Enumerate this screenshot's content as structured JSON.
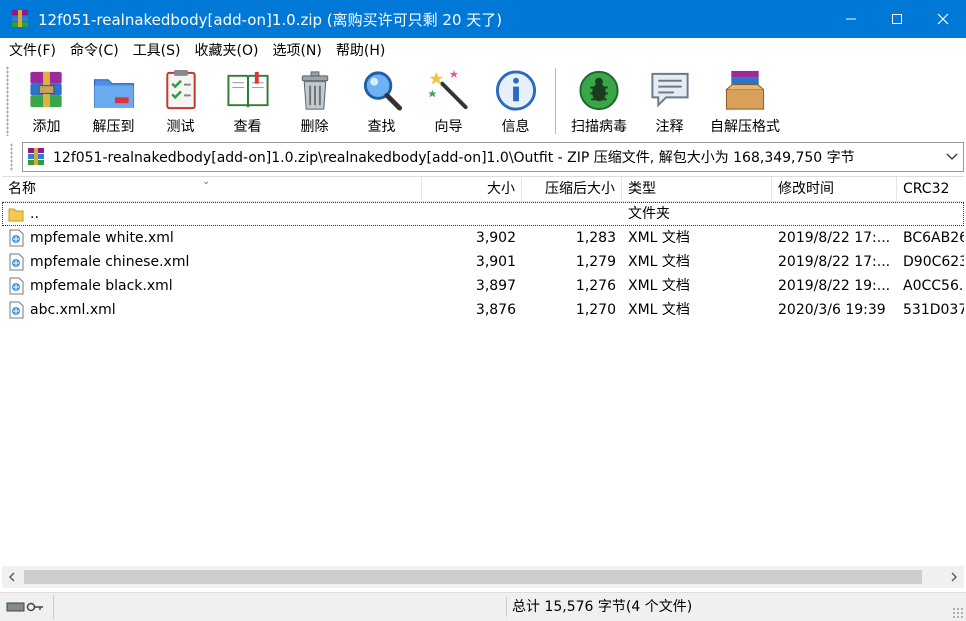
{
  "window": {
    "title": "12f051-realnakedbody[add-on]1.0.zip (离购买许可只剩 20 天了)",
    "accent_color": "#0078d7"
  },
  "menu": {
    "items": [
      "文件(F)",
      "命令(C)",
      "工具(S)",
      "收藏夹(O)",
      "选项(N)",
      "帮助(H)"
    ]
  },
  "toolbar": {
    "add": "添加",
    "extract": "解压到",
    "test": "测试",
    "view": "查看",
    "delete": "删除",
    "find": "查找",
    "wizard": "向导",
    "info": "信息",
    "scan": "扫描病毒",
    "comment": "注释",
    "sfx": "自解压格式"
  },
  "address": {
    "path": "12f051-realnakedbody[add-on]1.0.zip\\realnakedbody[add-on]1.0\\Outfit - ZIP 压缩文件, 解包大小为 168,349,750 字节"
  },
  "columns": {
    "name": "名称",
    "size": "大小",
    "packed": "压缩后大小",
    "type": "类型",
    "modified": "修改时间",
    "crc": "CRC32"
  },
  "rows": [
    {
      "name": "..",
      "size": "",
      "packed": "",
      "type": "文件夹",
      "modified": "",
      "crc": "",
      "icon": "folder-icon"
    },
    {
      "name": "mpfemale white.xml",
      "size": "3,902",
      "packed": "1,283",
      "type": "XML 文档",
      "modified": "2019/8/22 17:...",
      "crc": "BC6AB26",
      "icon": "xml-file-icon"
    },
    {
      "name": "mpfemale chinese.xml",
      "size": "3,901",
      "packed": "1,279",
      "type": "XML 文档",
      "modified": "2019/8/22 17:...",
      "crc": "D90C623",
      "icon": "xml-file-icon"
    },
    {
      "name": "mpfemale black.xml",
      "size": "3,897",
      "packed": "1,276",
      "type": "XML 文档",
      "modified": "2019/8/22 19:...",
      "crc": "A0CC56.",
      "icon": "xml-file-icon"
    },
    {
      "name": "abc.xml.xml",
      "size": "3,876",
      "packed": "1,270",
      "type": "XML 文档",
      "modified": "2020/3/6 19:39",
      "crc": "531D037",
      "icon": "xml-file-icon"
    }
  ],
  "status": {
    "summary": "总计 15,576 字节(4 个文件)"
  }
}
